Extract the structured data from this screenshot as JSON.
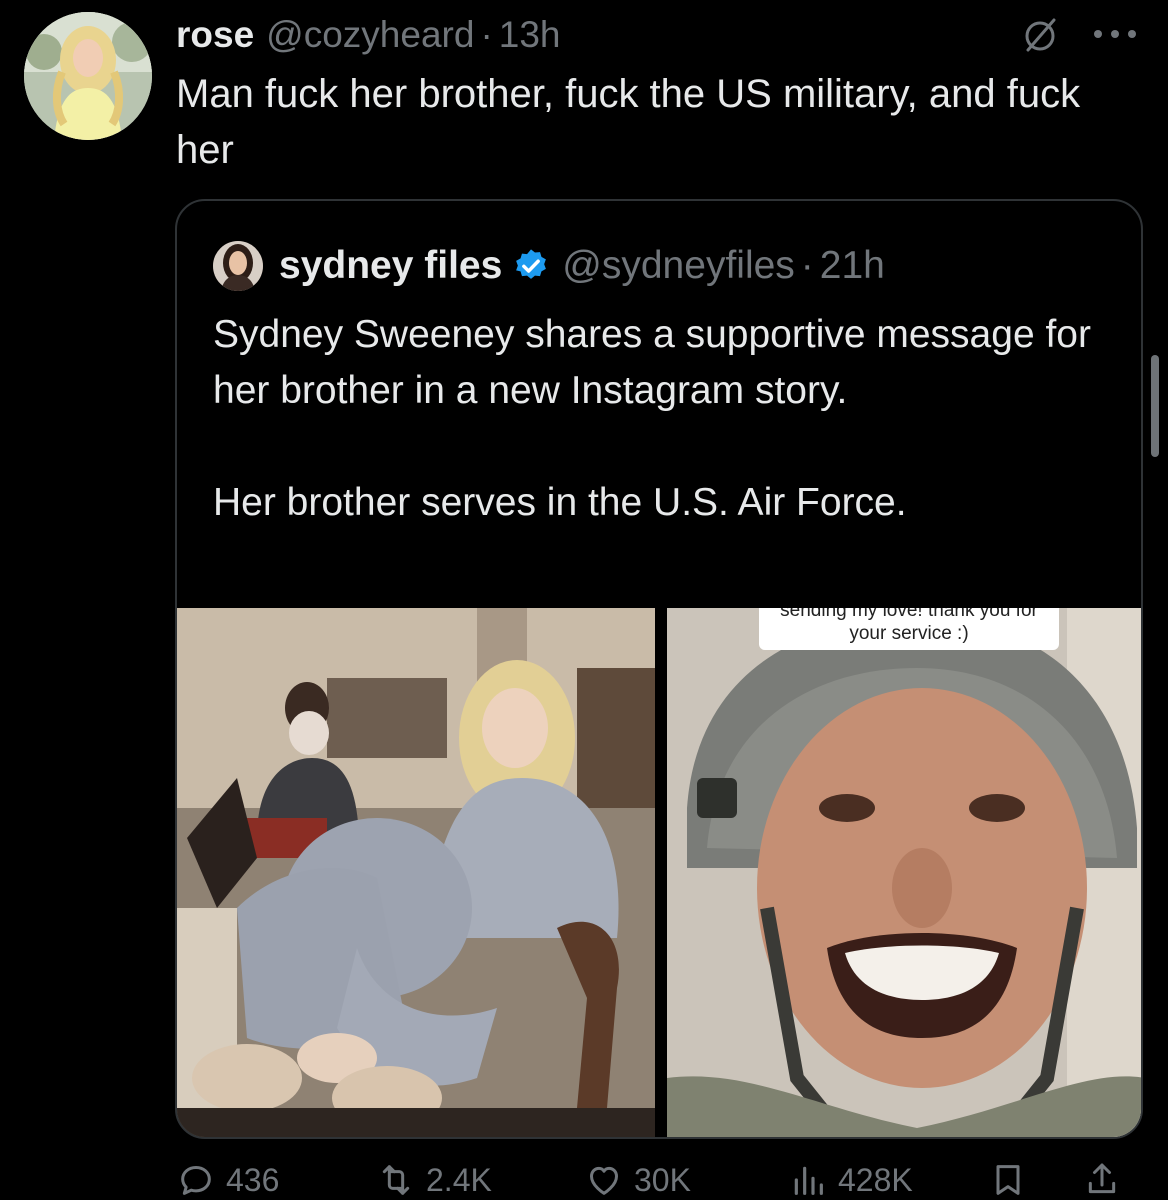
{
  "author": {
    "display_name": "rose",
    "handle": "@cozyheard",
    "separator": "·",
    "time": "13h"
  },
  "tweet": {
    "text": "Man fuck her brother, fuck the US military, and fuck her"
  },
  "quoted": {
    "display_name": "sydney files",
    "verified": true,
    "handle": "@sydneyfiles",
    "separator": "·",
    "time": "21h",
    "paragraph_1": "Sydney Sweeney shares a supportive message for her brother in a new Instagram story.",
    "paragraph_2": "Her brother serves in the U.S. Air Force.",
    "story_caption_line1": "sending my love! thank you for",
    "story_caption_line2": "your service :)"
  },
  "actions": {
    "replies": "436",
    "reposts": "2.4K",
    "likes": "30K",
    "views": "428K"
  },
  "icons": [
    "grok-icon",
    "more-icon",
    "verified-icon",
    "reply-icon",
    "repost-icon",
    "like-icon",
    "views-icon",
    "bookmark-icon",
    "share-icon"
  ],
  "colors": {
    "background": "#000000",
    "text": "#e7e9ea",
    "muted": "#71767b",
    "border": "#2f3336",
    "verified": "#1d9bf0"
  }
}
